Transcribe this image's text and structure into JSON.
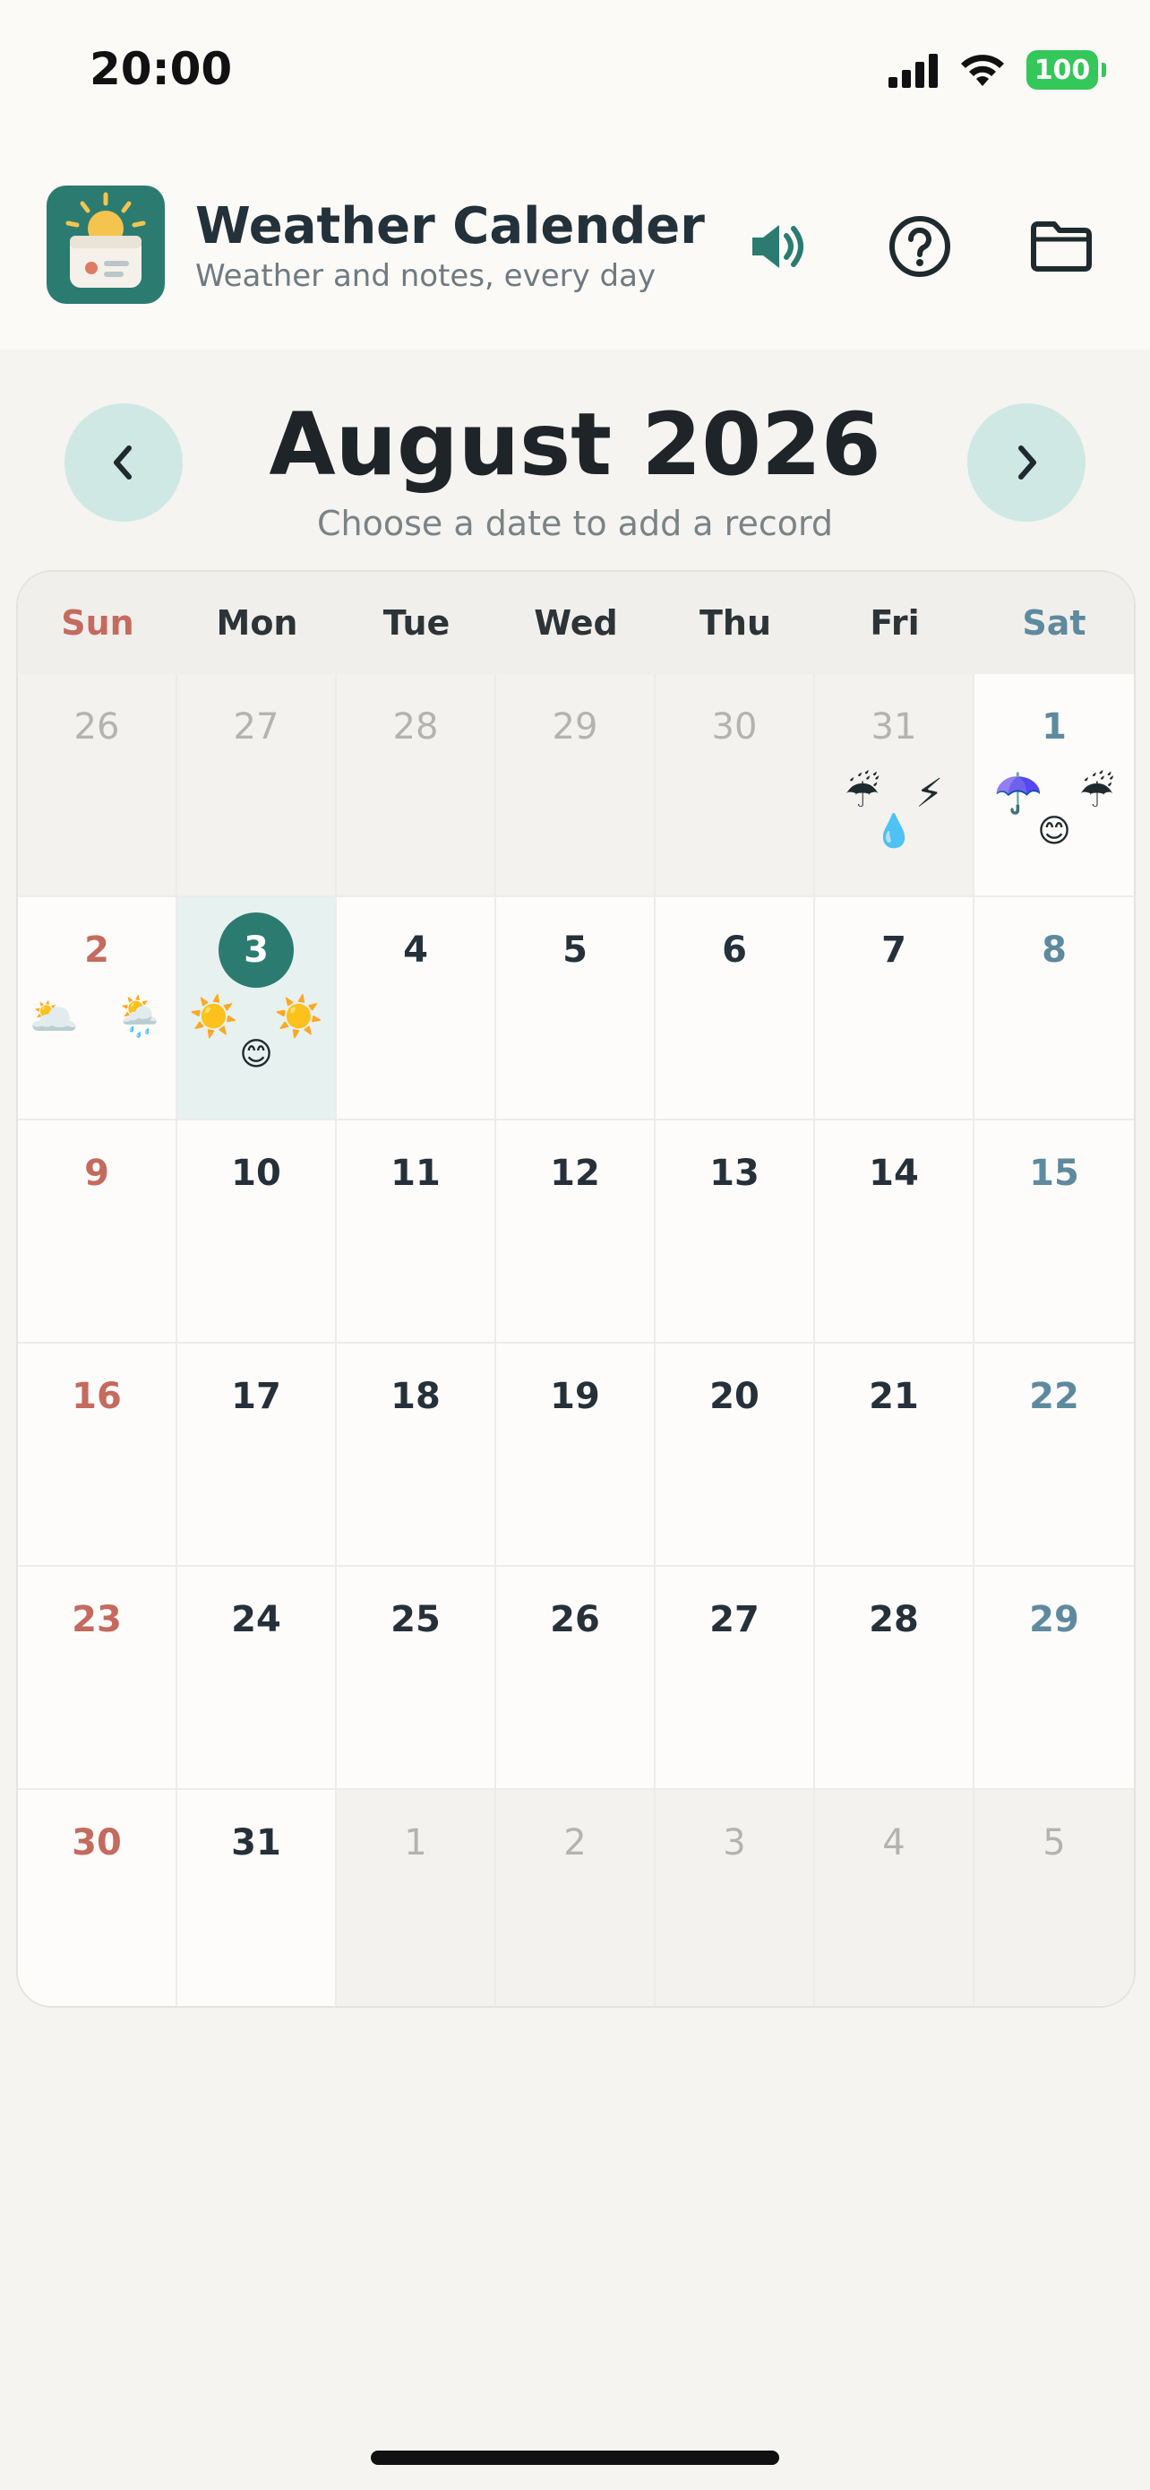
{
  "status_bar": {
    "time": "20:00",
    "battery": "100"
  },
  "header": {
    "title": "Weather Calender",
    "subtitle": "Weather and notes, every day"
  },
  "month_nav": {
    "title": "August 2026",
    "hint": "Choose a date to add a record"
  },
  "weekdays": [
    "Sun",
    "Mon",
    "Tue",
    "Wed",
    "Thu",
    "Fri",
    "Sat"
  ],
  "weeks": [
    [
      {
        "day": "26",
        "other": true
      },
      {
        "day": "27",
        "other": true
      },
      {
        "day": "28",
        "other": true
      },
      {
        "day": "29",
        "other": true
      },
      {
        "day": "30",
        "other": true
      },
      {
        "day": "31",
        "other": true,
        "icons": [
          "☔",
          "⚡"
        ],
        "mood": "💧"
      },
      {
        "day": "1",
        "icons": [
          "☂️",
          "☔"
        ],
        "mood": "😊"
      }
    ],
    [
      {
        "day": "2",
        "icons": [
          "🌥️",
          "🌦️"
        ]
      },
      {
        "day": "3",
        "selected": true,
        "icons": [
          "☀️",
          "☀️"
        ],
        "mood": "😊"
      },
      {
        "day": "4"
      },
      {
        "day": "5"
      },
      {
        "day": "6"
      },
      {
        "day": "7"
      },
      {
        "day": "8"
      }
    ],
    [
      {
        "day": "9"
      },
      {
        "day": "10"
      },
      {
        "day": "11"
      },
      {
        "day": "12"
      },
      {
        "day": "13"
      },
      {
        "day": "14"
      },
      {
        "day": "15"
      }
    ],
    [
      {
        "day": "16"
      },
      {
        "day": "17"
      },
      {
        "day": "18"
      },
      {
        "day": "19"
      },
      {
        "day": "20"
      },
      {
        "day": "21"
      },
      {
        "day": "22"
      }
    ],
    [
      {
        "day": "23"
      },
      {
        "day": "24"
      },
      {
        "day": "25"
      },
      {
        "day": "26"
      },
      {
        "day": "27"
      },
      {
        "day": "28"
      },
      {
        "day": "29"
      }
    ],
    [
      {
        "day": "30"
      },
      {
        "day": "31"
      },
      {
        "day": "1",
        "other": true
      },
      {
        "day": "2",
        "other": true
      },
      {
        "day": "3",
        "other": true
      },
      {
        "day": "4",
        "other": true
      },
      {
        "day": "5",
        "other": true
      }
    ]
  ],
  "colors": {
    "accent": "#2b7b71",
    "nav_button": "#cfe8e4",
    "sunday": "#c56a5e",
    "saturday": "#5e8aa0"
  },
  "icons": {
    "sound": "speaker-icon",
    "help": "help-icon",
    "folder": "folder-icon",
    "prev": "chevron-left-icon",
    "next": "chevron-right-icon"
  }
}
